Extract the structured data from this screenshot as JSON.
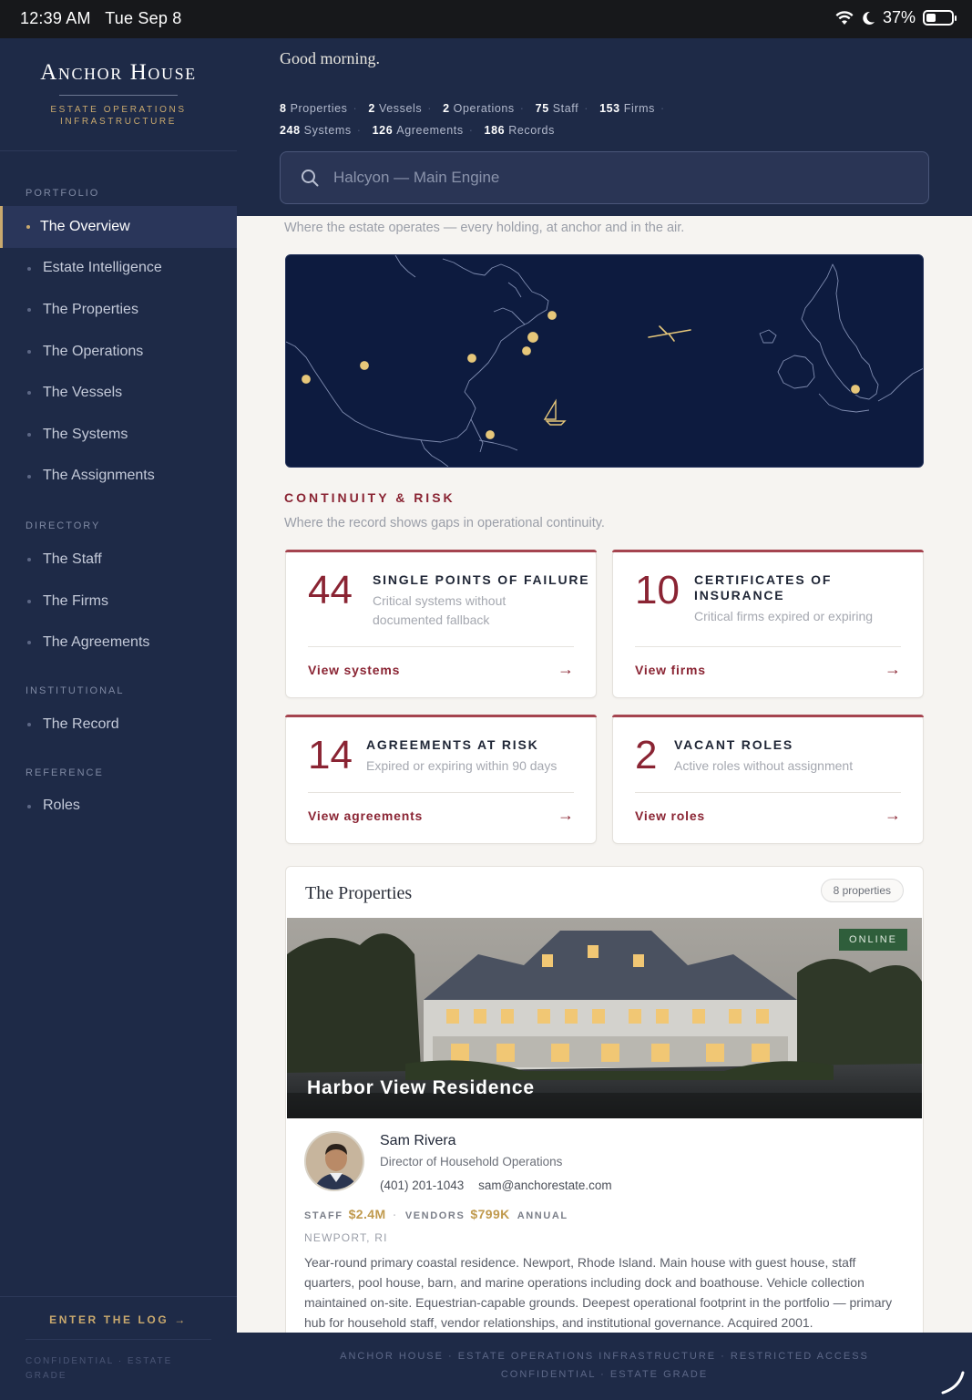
{
  "status": {
    "time": "12:39 AM",
    "date": "Tue Sep 8",
    "battery": "37%"
  },
  "brand": {
    "name": "Anchor House",
    "tagline": "ESTATE OPERATIONS INFRASTRUCTURE"
  },
  "sidebar": {
    "sections": [
      {
        "label": "PORTFOLIO",
        "items": [
          "The Overview",
          "Estate Intelligence",
          "The Properties",
          "The Operations",
          "The Vessels",
          "The Systems",
          "The Assignments"
        ]
      },
      {
        "label": "DIRECTORY",
        "items": [
          "The Staff",
          "The Firms",
          "The Agreements"
        ]
      },
      {
        "label": "INSTITUTIONAL",
        "items": [
          "The Record"
        ]
      },
      {
        "label": "REFERENCE",
        "items": [
          "Roles"
        ]
      }
    ],
    "active": "The Overview",
    "enter_log": "ENTER THE LOG →",
    "confidential": "CONFIDENTIAL · ESTATE GRADE"
  },
  "header": {
    "greeting": "Good morning.",
    "stats": [
      {
        "n": "8",
        "label": "Properties"
      },
      {
        "n": "2",
        "label": "Vessels"
      },
      {
        "n": "2",
        "label": "Operations"
      },
      {
        "n": "75",
        "label": "Staff"
      },
      {
        "n": "153",
        "label": "Firms"
      },
      {
        "n": "248",
        "label": "Systems"
      },
      {
        "n": "126",
        "label": "Agreements"
      },
      {
        "n": "186",
        "label": "Records"
      }
    ],
    "search_placeholder": "Halcyon — Main Engine"
  },
  "map": {
    "subtitle": "Where the estate operates — every holding, at anchor and in the air."
  },
  "continuity": {
    "title": "CONTINUITY & RISK",
    "subtitle": "Where the record shows gaps in operational continuity.",
    "cards": [
      {
        "num": "44",
        "title": "SINGLE POINTS OF FAILURE",
        "desc": "Critical systems without documented fallback",
        "link": "View systems"
      },
      {
        "num": "10",
        "title": "CERTIFICATES OF INSURANCE",
        "desc": "Critical firms expired or expiring",
        "link": "View firms"
      },
      {
        "num": "14",
        "title": "AGREEMENTS AT RISK",
        "desc": "Expired or expiring within 90 days",
        "link": "View agreements"
      },
      {
        "num": "2",
        "title": "VACANT ROLES",
        "desc": "Active roles without assignment",
        "link": "View roles"
      }
    ]
  },
  "properties": {
    "title": "The Properties",
    "count": "8 properties",
    "featured": {
      "status": "ONLINE",
      "name": "Harbor View Residence",
      "contact_name": "Sam Rivera",
      "contact_role": "Director of Household Operations",
      "phone": "(401) 201-1043",
      "email": "sam@anchorestate.com",
      "staff_label": "STAFF",
      "staff_value": "$2.4M",
      "vendors_label": "VENDORS",
      "vendors_value": "$799K",
      "annual_label": "ANNUAL",
      "location": "NEWPORT, RI",
      "description": "Year-round primary coastal residence. Newport, Rhode Island. Main house with guest house, staff quarters, pool house, barn, and marine operations including dock and boathouse. Vehicle collection maintained on-site. Equestrian-capable grounds. Deepest operational footprint in the portfolio — primary hub for household staff, vendor relationships, and institutional governance. Acquired 2001."
    }
  },
  "footer": {
    "line1": "ANCHOR HOUSE · ESTATE OPERATIONS INFRASTRUCTURE · RESTRICTED ACCESS",
    "line2": "CONFIDENTIAL · ESTATE GRADE"
  },
  "colors": {
    "navy": "#1e2a47",
    "gold": "#c9a96e",
    "crimson": "#8a2433",
    "online": "#2f5e3b"
  }
}
